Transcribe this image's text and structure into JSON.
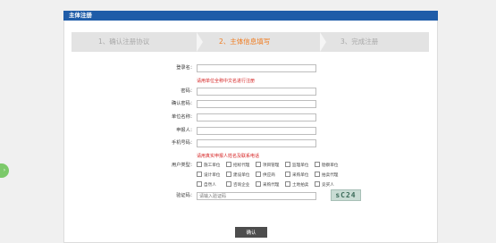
{
  "header": {
    "title": "主体注册"
  },
  "steps": [
    {
      "label": "1、确认注册协议"
    },
    {
      "label": "2、主体信息填写"
    },
    {
      "label": "3、完成注册"
    }
  ],
  "form": {
    "login_name_label": "登录名：",
    "hint_name": "请用单位全称中文名进行注册",
    "password_label": "密码：",
    "confirm_password_label": "确认密码：",
    "org_name_label": "单位名称：",
    "reporter_label": "申报人：",
    "phone_label": "手机号码：",
    "hint_reporter": "请用真实申报人姓名及联系电话",
    "user_type_label": "用户类型：",
    "user_types_row1": [
      "施工单位",
      "招标代理",
      "项目管理",
      "监理单位",
      "勘察单位"
    ],
    "user_types_row2": [
      "设计单位",
      "建设单位",
      "供应商",
      "采购单位",
      "拍卖代理"
    ],
    "user_types_row3": [
      "自然人",
      "咨询企业",
      "采购代理",
      "土地拍卖",
      "竞买人"
    ],
    "captcha_label": "验证码：",
    "captcha_placeholder": "请输入验证码",
    "captcha_text": "sC24",
    "submit_label": "确认"
  },
  "colors": {
    "header_bg": "#1f5ca8",
    "active_step": "#f07b1e",
    "hint": "#d51f1f"
  }
}
